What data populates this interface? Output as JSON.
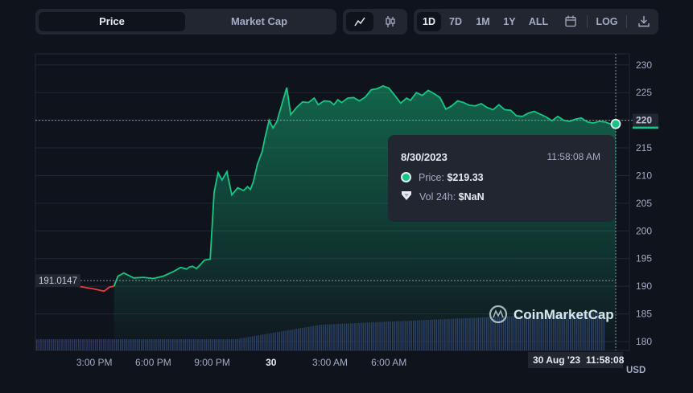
{
  "toolbar": {
    "price_tab": "Price",
    "market_cap_tab": "Market Cap",
    "ranges": [
      "1D",
      "7D",
      "1M",
      "1Y",
      "ALL"
    ],
    "active_range": "1D",
    "log_label": "LOG",
    "icons": [
      "line-chart-icon",
      "candlestick-icon",
      "calendar-icon",
      "download-icon"
    ]
  },
  "chart_data": {
    "type": "area",
    "y_ticks": [
      "230",
      "225",
      "220",
      "215",
      "210",
      "205",
      "200",
      "195",
      "190",
      "185",
      "180"
    ],
    "x_ticks": [
      "3:00 PM",
      "6:00 PM",
      "9:00 PM",
      "30",
      "3:00 AM",
      "6:00 AM"
    ],
    "y_unit": "USD",
    "ylim": [
      178.4,
      232
    ],
    "open_price_label": "191.0147",
    "current_price_label": "220",
    "crosshair_date_label": "30 Aug '23",
    "crosshair_time_label": "11:58:08",
    "watermark": "CoinMarketCap",
    "colors": {
      "up": "#16c784",
      "down": "#ea3943"
    },
    "series": [
      {
        "name": "Price",
        "x": [
          0.0,
          0.5,
          1.0,
          1.5,
          2.0,
          2.5,
          3.0,
          3.5,
          3.75,
          4.0,
          4.2,
          4.5,
          5.0,
          5.5,
          6.0,
          6.5,
          7.0,
          7.2,
          7.4,
          7.7,
          7.85,
          8.0,
          8.2,
          8.4,
          8.6,
          8.9,
          9.1,
          9.3,
          9.5,
          9.75,
          10.0,
          10.3,
          10.6,
          10.8,
          10.95,
          11.1,
          11.3,
          11.55,
          11.7,
          11.9,
          12.1,
          12.3,
          12.6,
          12.8,
          13.0,
          13.3,
          13.6,
          13.9,
          14.2,
          14.4,
          14.7,
          15.0,
          15.2,
          15.4,
          15.6,
          15.9,
          16.2,
          16.5,
          16.8,
          17.1,
          17.4,
          17.7,
          18.0,
          18.3,
          18.6,
          18.9,
          19.1,
          19.4,
          19.7,
          20.0,
          20.3,
          20.6,
          20.9,
          21.2,
          21.5,
          21.8,
          22.1,
          22.4,
          22.7,
          23.0,
          23.3,
          23.6,
          23.9,
          24.2,
          24.5,
          24.8,
          25.1,
          25.4,
          25.7,
          26.0,
          26.3,
          26.6,
          26.9,
          27.2,
          27.5,
          27.8,
          28.1,
          28.4,
          28.7,
          29.0,
          29.3,
          29.55
        ],
        "values": [
          191.0,
          190.2,
          190.4,
          190.3,
          190.1,
          189.8,
          189.5,
          189.1,
          189.8,
          190.0,
          191.8,
          192.4,
          191.5,
          191.6,
          191.4,
          191.8,
          192.6,
          193.0,
          193.4,
          193.1,
          193.5,
          193.6,
          193.2,
          193.9,
          194.7,
          194.9,
          207.0,
          210.5,
          209.2,
          210.7,
          206.5,
          207.8,
          207.3,
          208.0,
          207.5,
          208.9,
          212.0,
          214.4,
          217.0,
          220.0,
          218.6,
          219.8,
          223.5,
          225.9,
          221.0,
          222.3,
          223.3,
          223.2,
          224.0,
          222.8,
          223.5,
          223.4,
          222.8,
          223.7,
          223.2,
          224.0,
          224.1,
          223.5,
          224.2,
          225.5,
          225.7,
          226.2,
          225.8,
          224.5,
          223.1,
          224.0,
          223.6,
          225.0,
          224.5,
          225.4,
          224.8,
          224.1,
          222.0,
          222.6,
          223.5,
          223.2,
          222.7,
          222.6,
          223.0,
          222.3,
          221.9,
          222.8,
          221.9,
          221.8,
          220.8,
          220.7,
          221.3,
          221.6,
          221.1,
          220.6,
          219.9,
          220.7,
          220.0,
          219.8,
          220.2,
          220.4,
          219.7,
          219.5,
          219.8,
          219.7,
          219.3,
          219.33
        ]
      }
    ]
  },
  "tooltip": {
    "date": "8/30/2023",
    "time": "11:58:08 AM",
    "price_label": "Price:",
    "price_value": "$219.33",
    "vol_label": "Vol 24h:",
    "vol_value": "$NaN"
  }
}
